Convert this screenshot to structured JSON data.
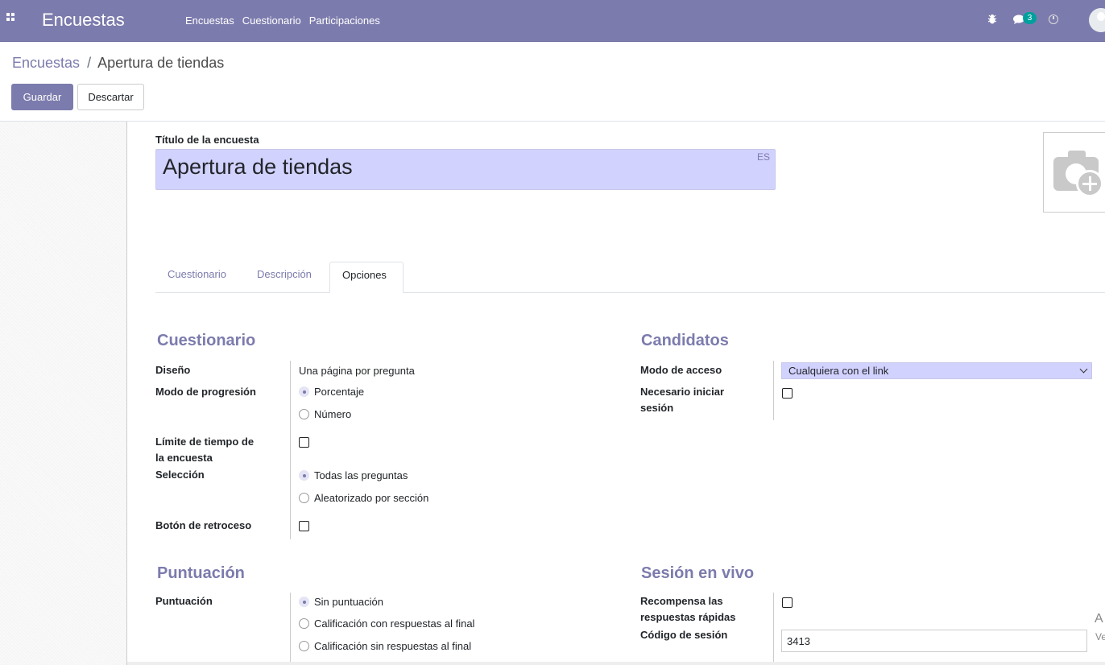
{
  "navbar": {
    "app_name": "Encuestas",
    "menu": [
      "Encuestas",
      "Cuestionario",
      "Participaciones"
    ],
    "chat_count": "3"
  },
  "breadcrumb": {
    "parent": "Encuestas",
    "separator": "/",
    "current": "Apertura de tiendas"
  },
  "buttons": {
    "save": "Guardar",
    "discard": "Descartar"
  },
  "form": {
    "title_label": "Título de la encuesta",
    "title_value": "Apertura de tiendas",
    "lang": "ES"
  },
  "tabs": [
    "Cuestionario",
    "Descripción",
    "Opciones"
  ],
  "cuestionario": {
    "heading": "Cuestionario",
    "diseno_label": "Diseño",
    "diseno_value": "Una página por pregunta",
    "progression_label": "Modo de progresión",
    "progression_options": [
      "Porcentaje",
      "Número"
    ],
    "time_limit_label_1": "Límite de tiempo de",
    "time_limit_label_2": "la encuesta",
    "selection_label": "Selección",
    "selection_options": [
      "Todas las preguntas",
      "Aleatorizado por sección"
    ],
    "back_button_label": "Botón de retroceso"
  },
  "candidatos": {
    "heading": "Candidatos",
    "access_label": "Modo de acceso",
    "access_value": "Cualquiera con el link",
    "login_label_1": "Necesario iniciar",
    "login_label_2": "sesión"
  },
  "puntuacion": {
    "heading": "Puntuación",
    "label": "Puntuación",
    "options": [
      "Sin puntuación",
      "Calificación con respuestas al final",
      "Calificación sin respuestas al final"
    ]
  },
  "sesion": {
    "heading": "Sesión en vivo",
    "reward_label_1": "Recompensa las",
    "reward_label_2": "respuestas rápidas",
    "code_label": "Código de sesión",
    "code_value": "3413"
  },
  "side_truncated": {
    "a": "A",
    "ve": "Ve"
  }
}
